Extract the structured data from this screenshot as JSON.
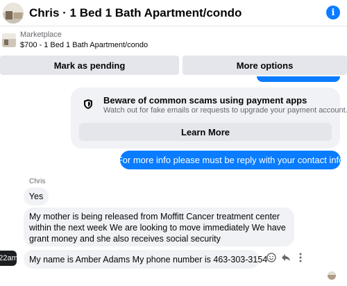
{
  "header": {
    "title": "Chris · 1 Bed 1 Bath Apartment/condo",
    "info_label": "i"
  },
  "marketplace": {
    "label": "Marketplace",
    "item": "$700 - 1 Bed 1 Bath Apartment/condo"
  },
  "actions": {
    "mark_pending": "Mark as pending",
    "more_options": "More options"
  },
  "warning": {
    "title": "Beware of common scams using payment apps",
    "subtitle": "Watch out for fake emails or requests to upgrade your payment account.",
    "button": "Learn More"
  },
  "messages": {
    "outgoing_1": "For more info please must be reply with your contact info",
    "sender": "Chris",
    "incoming_1": "Yes",
    "incoming_2": "My mother is being released from Moffitt Cancer treatment center within the next week We are looking to move immediately We have grant money and she also receives social security",
    "incoming_3": "My name is Amber Adams My phone number is 463-303-3154"
  },
  "timestamp": "22am",
  "colors": {
    "accent": "#0a7cff",
    "bubble_gray": "#f0f2f5",
    "button_gray": "#e4e6eb"
  }
}
